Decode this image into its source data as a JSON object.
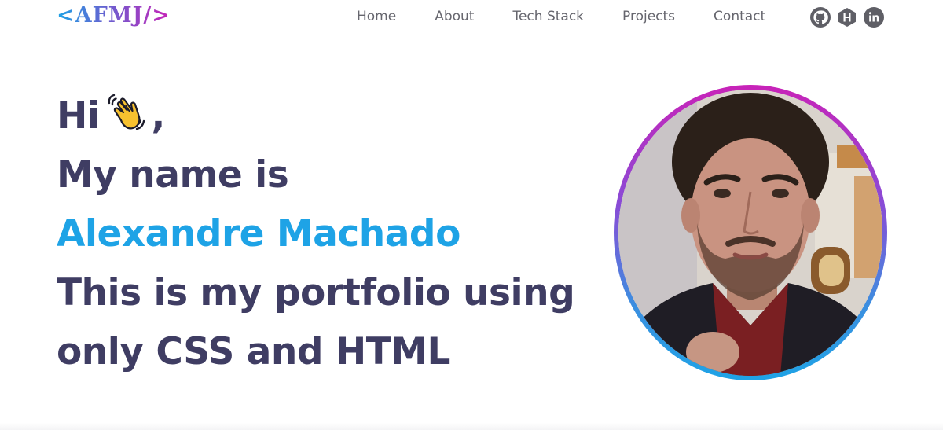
{
  "header": {
    "logo": "<AFMJ/>",
    "nav": [
      "Home",
      "About",
      "Tech Stack",
      "Projects",
      "Contact"
    ],
    "social": [
      {
        "icon": "github-icon"
      },
      {
        "icon": "hashnode-icon"
      },
      {
        "icon": "linkedin-icon"
      }
    ]
  },
  "hero": {
    "greeting": "Hi",
    "greeting_suffix": ",",
    "wave_icon": "waving-hand-icon",
    "intro": "My name is",
    "name": "Alexandre Machado",
    "line3": "This is my portfolio using",
    "line4": "only CSS and HTML"
  },
  "colors": {
    "heading": "#3f3d63",
    "accent": "#1ea3e6",
    "gradient_start": "#1ea3e6",
    "gradient_end": "#c823b8",
    "nav_text": "#66666e"
  }
}
